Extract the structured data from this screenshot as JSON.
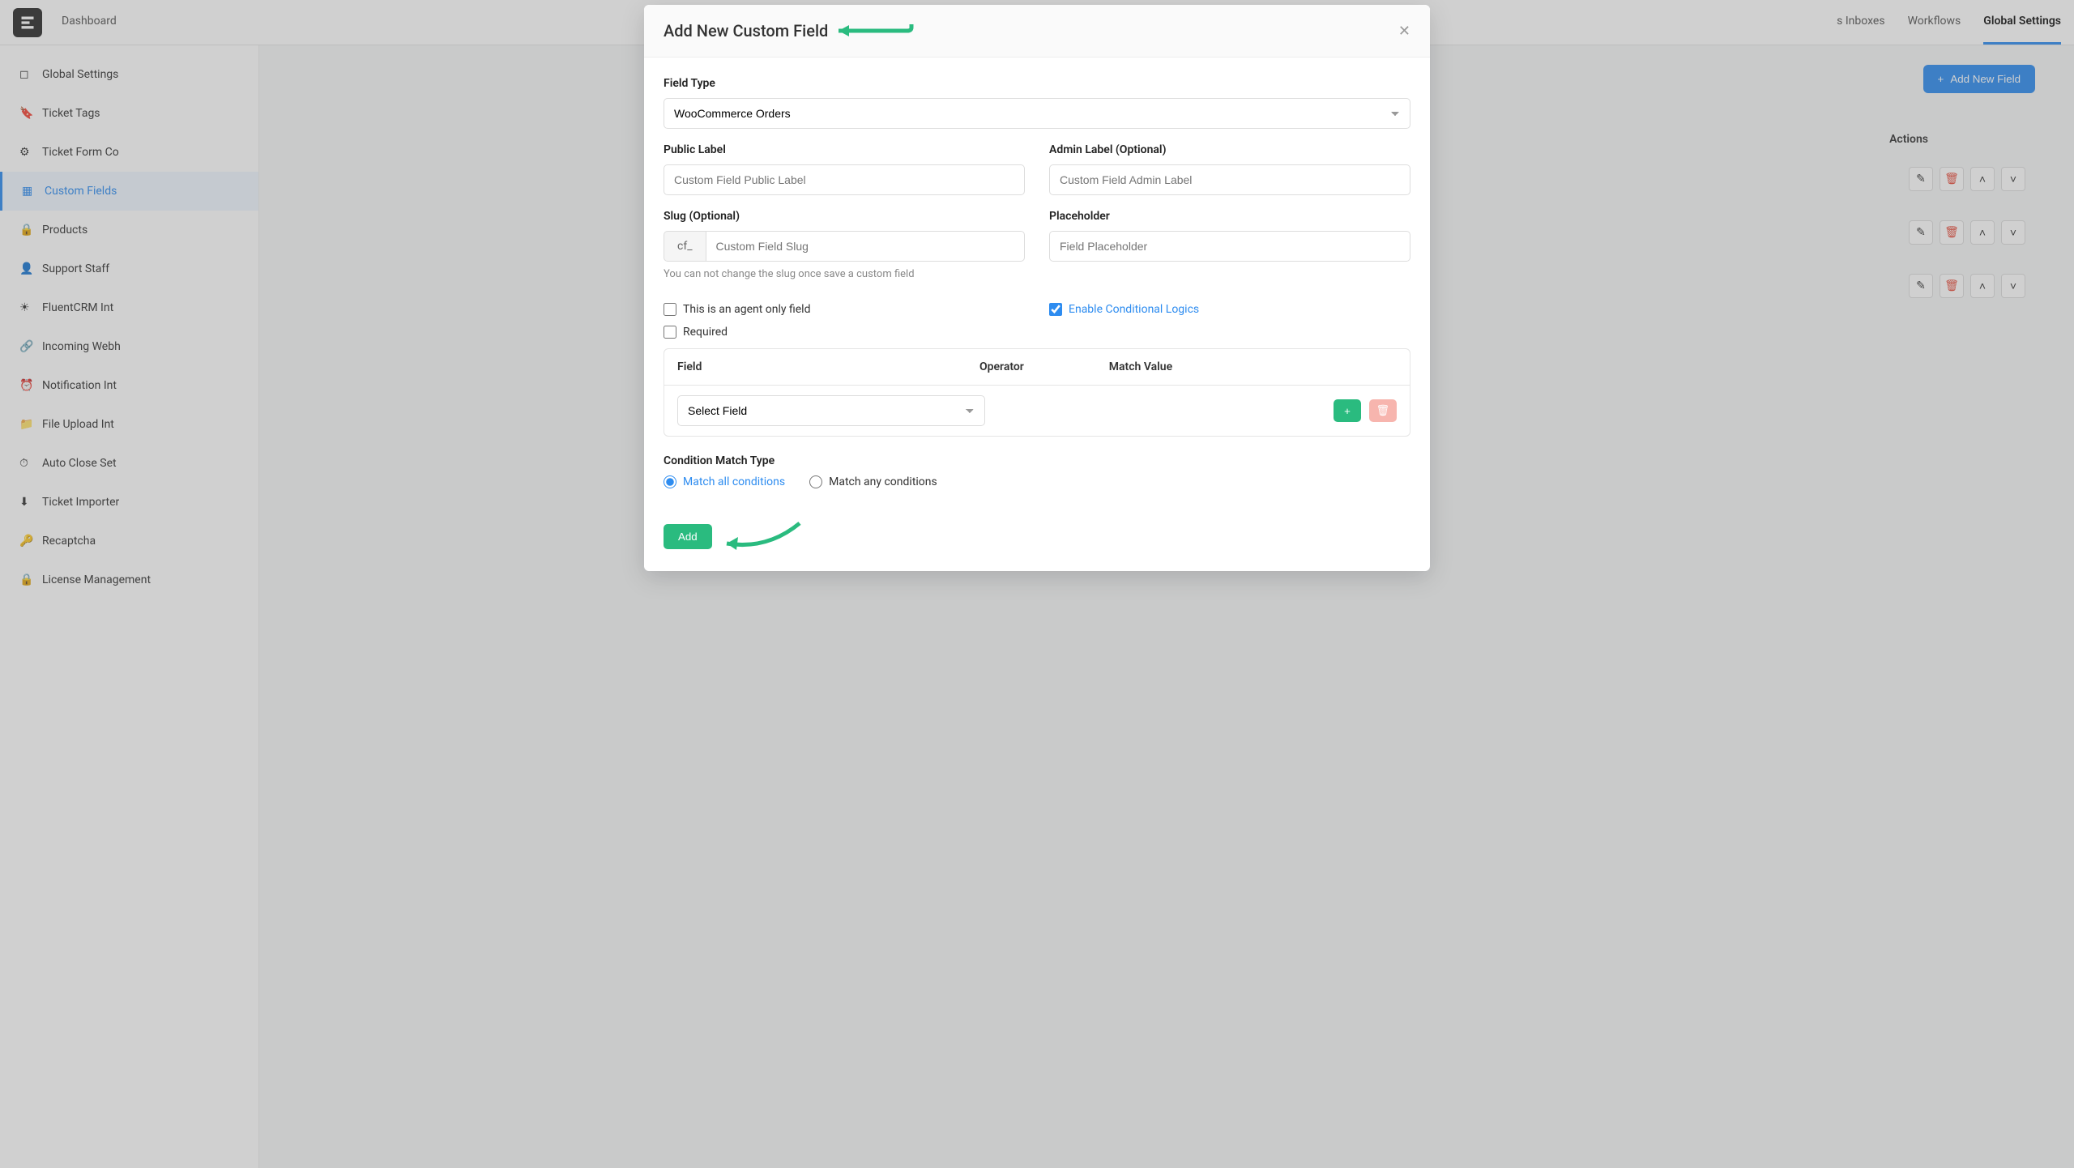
{
  "topnav": {
    "items": [
      "Dashboard",
      "s Inboxes",
      "Workflows",
      "Global Settings"
    ],
    "active": "Global Settings"
  },
  "sidebar": {
    "items": [
      {
        "label": "Global Settings",
        "icon": "settings"
      },
      {
        "label": "Ticket Tags",
        "icon": "tag"
      },
      {
        "label": "Ticket Form Co",
        "icon": "gear"
      },
      {
        "label": "Custom Fields",
        "icon": "fields",
        "active": true
      },
      {
        "label": "Products",
        "icon": "lock"
      },
      {
        "label": "Support Staff",
        "icon": "user"
      },
      {
        "label": "FluentCRM Int",
        "icon": "sun"
      },
      {
        "label": "Incoming Webh",
        "icon": "link"
      },
      {
        "label": "Notification Int",
        "icon": "clock"
      },
      {
        "label": "File Upload Int",
        "icon": "folder"
      },
      {
        "label": "Auto Close Set",
        "icon": "timer"
      },
      {
        "label": "Ticket Importer",
        "icon": "download"
      },
      {
        "label": "Recaptcha",
        "icon": "key"
      },
      {
        "label": "License Management",
        "icon": "lock"
      }
    ]
  },
  "content": {
    "addButton": "Add New Field",
    "actionsHeader": "Actions"
  },
  "modal": {
    "title": "Add New Custom Field",
    "fieldType": {
      "label": "Field Type",
      "value": "WooCommerce Orders"
    },
    "publicLabel": {
      "label": "Public Label",
      "placeholder": "Custom Field Public Label"
    },
    "adminLabel": {
      "label": "Admin Label (Optional)",
      "placeholder": "Custom Field Admin Label"
    },
    "slug": {
      "label": "Slug (Optional)",
      "prefix": "cf_",
      "placeholder": "Custom Field Slug",
      "help": "You can not change the slug once save a custom field"
    },
    "placeholder": {
      "label": "Placeholder",
      "placeholder": "Field Placeholder"
    },
    "agentOnly": "This is an agent only field",
    "enableConditional": "Enable Conditional Logics",
    "required": "Required",
    "condTable": {
      "field": "Field",
      "operator": "Operator",
      "matchValue": "Match Value",
      "selectField": "Select Field"
    },
    "matchType": {
      "label": "Condition Match Type",
      "all": "Match all conditions",
      "any": "Match any conditions"
    },
    "submit": "Add"
  }
}
